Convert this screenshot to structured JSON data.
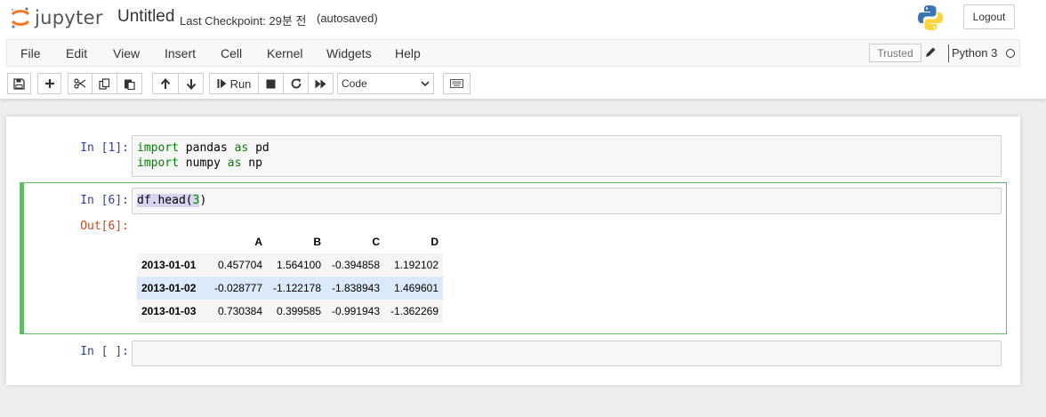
{
  "header": {
    "logo_text": "jupyter",
    "notebook_title": "Untitled",
    "checkpoint": "Last Checkpoint: 29분 전",
    "autosave": "(autosaved)",
    "logout_label": "Logout"
  },
  "menubar": {
    "items": [
      "File",
      "Edit",
      "View",
      "Insert",
      "Cell",
      "Kernel",
      "Widgets",
      "Help"
    ],
    "trusted_label": "Trusted",
    "kernel_name": "Python 3"
  },
  "toolbar": {
    "run_label": "Run",
    "cell_type": "Code"
  },
  "cells": [
    {
      "prompt": "In [1]:",
      "code_lines": [
        {
          "kw": "import",
          "rest1": " pandas ",
          "kw2": "as",
          "rest2": " pd"
        },
        {
          "kw": "import",
          "rest1": " numpy ",
          "kw2": "as",
          "rest2": " np"
        }
      ]
    },
    {
      "prompt": "In [6]:",
      "code_prefix": "df.head(",
      "code_num": "3",
      "code_suffix": ")",
      "out_prompt": "Out[6]:",
      "output_table": {
        "columns": [
          "A",
          "B",
          "C",
          "D"
        ],
        "rows": [
          {
            "index": "2013-01-01",
            "values": [
              "0.457704",
              "1.564100",
              "-0.394858",
              "1.192102"
            ]
          },
          {
            "index": "2013-01-02",
            "values": [
              "-0.028777",
              "-1.122178",
              "-1.838943",
              "1.469601"
            ]
          },
          {
            "index": "2013-01-03",
            "values": [
              "0.730384",
              "0.399585",
              "-0.991943",
              "-1.362269"
            ]
          }
        ]
      }
    },
    {
      "prompt": "In [ ]:"
    }
  ],
  "colors": {
    "prompt_in": "#303f9f",
    "prompt_out": "#d84315",
    "selected_cell_border": "#66bb6a",
    "keyword": "#008000"
  }
}
